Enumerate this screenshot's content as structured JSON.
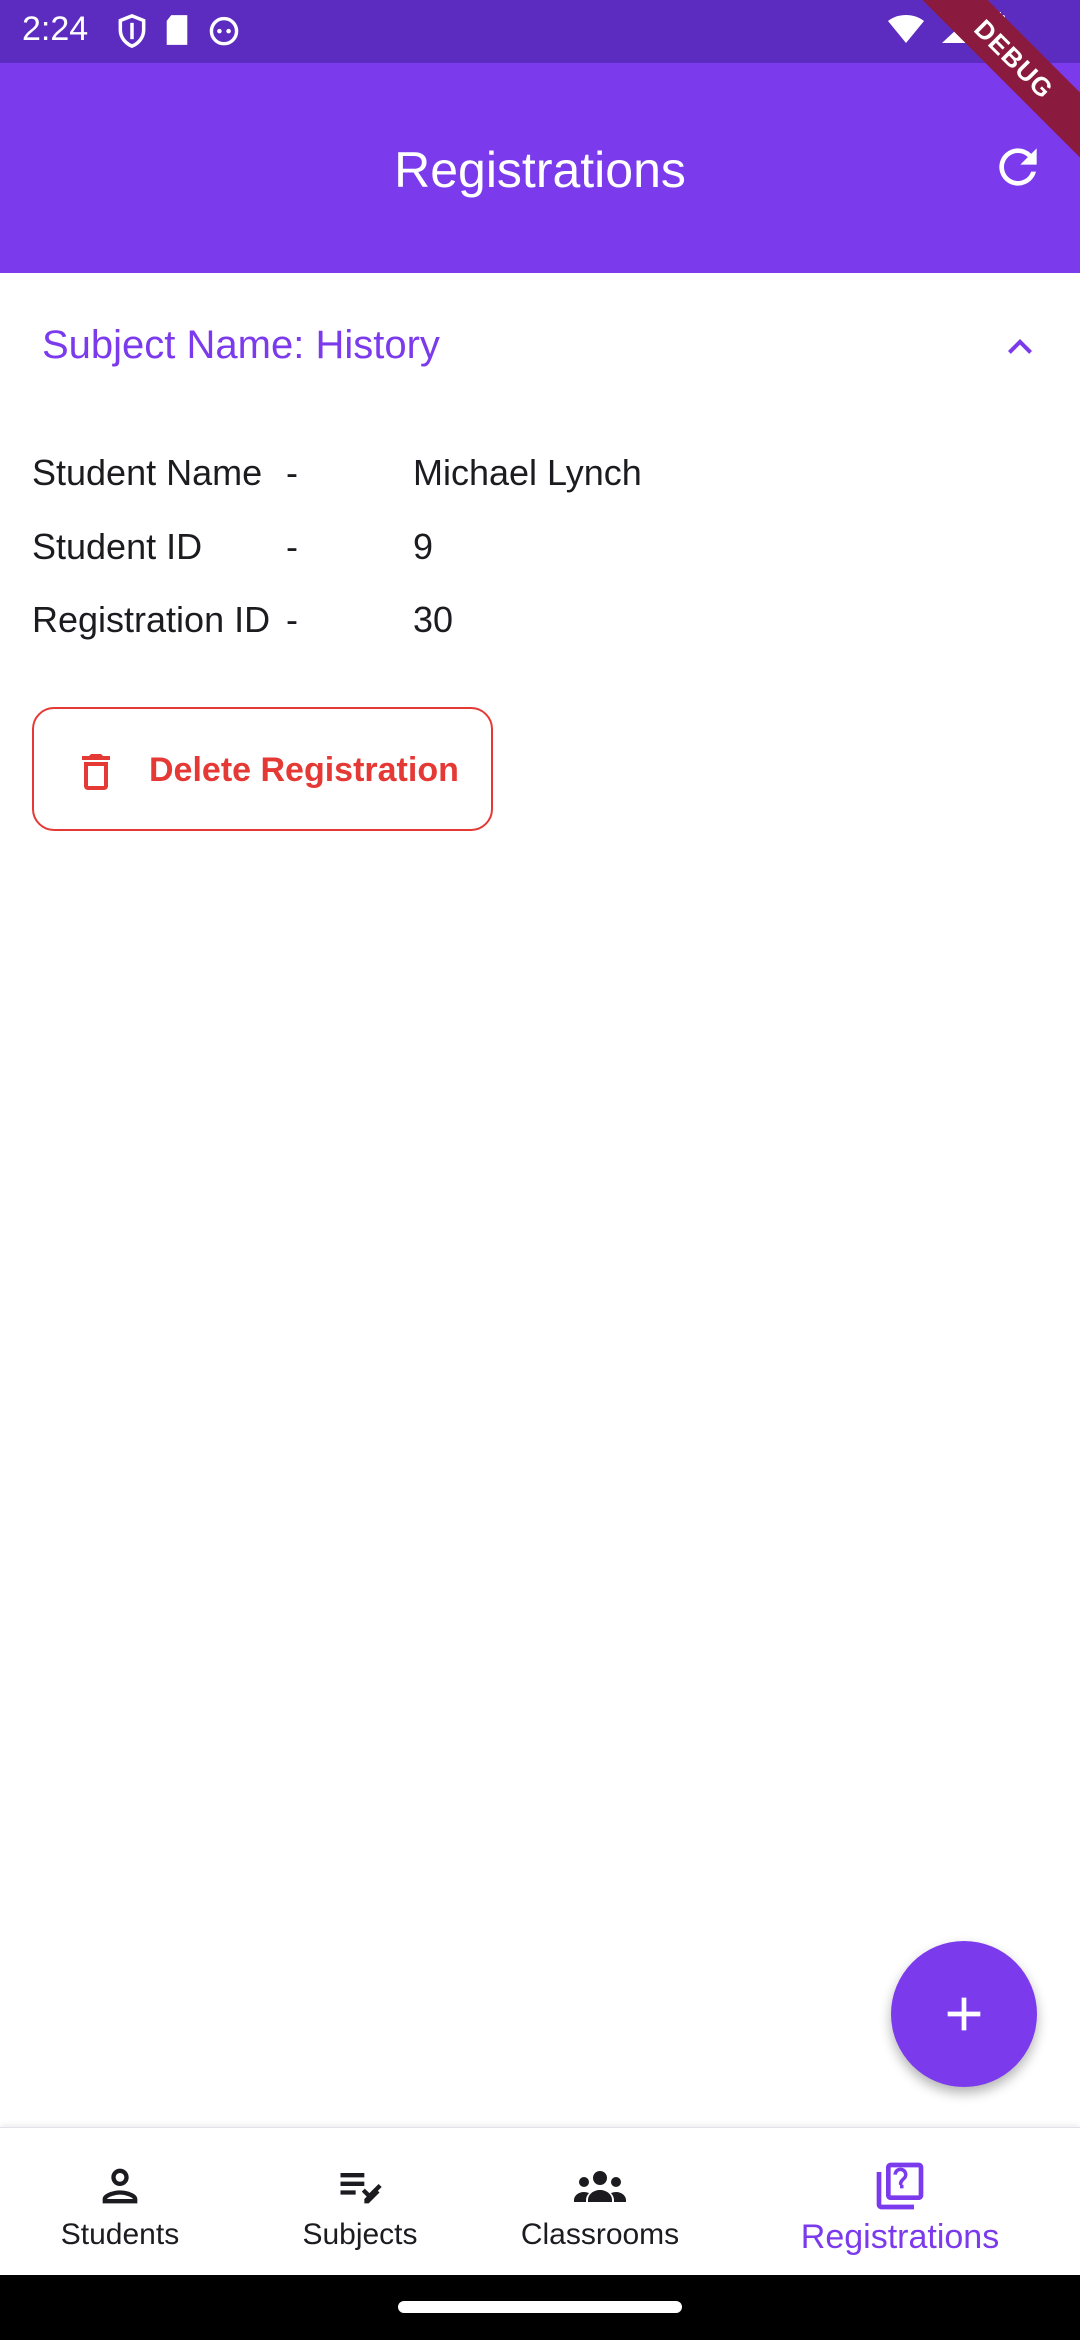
{
  "status_bar": {
    "time": "2:24",
    "debug_label": "DEBUG"
  },
  "app_bar": {
    "title": "Registrations"
  },
  "registration": {
    "subject_label": "Subject Name: History",
    "rows": [
      {
        "label": "Student Name",
        "separator": "-",
        "value": "Michael Lynch"
      },
      {
        "label": "Student ID",
        "separator": "-",
        "value": "9"
      },
      {
        "label": "Registration ID",
        "separator": "-",
        "value": "30"
      }
    ],
    "delete_label": "Delete Registration"
  },
  "bottom_nav": {
    "items": [
      {
        "label": "Students",
        "icon": "person-icon"
      },
      {
        "label": "Subjects",
        "icon": "edit-list-icon"
      },
      {
        "label": "Classrooms",
        "icon": "groups-icon"
      },
      {
        "label": "Registrations",
        "icon": "quiz-icon"
      }
    ],
    "active": "Registrations"
  },
  "colors": {
    "primary": "#7c3aed",
    "status_bar": "#5b2cbf",
    "danger": "#e53935"
  }
}
